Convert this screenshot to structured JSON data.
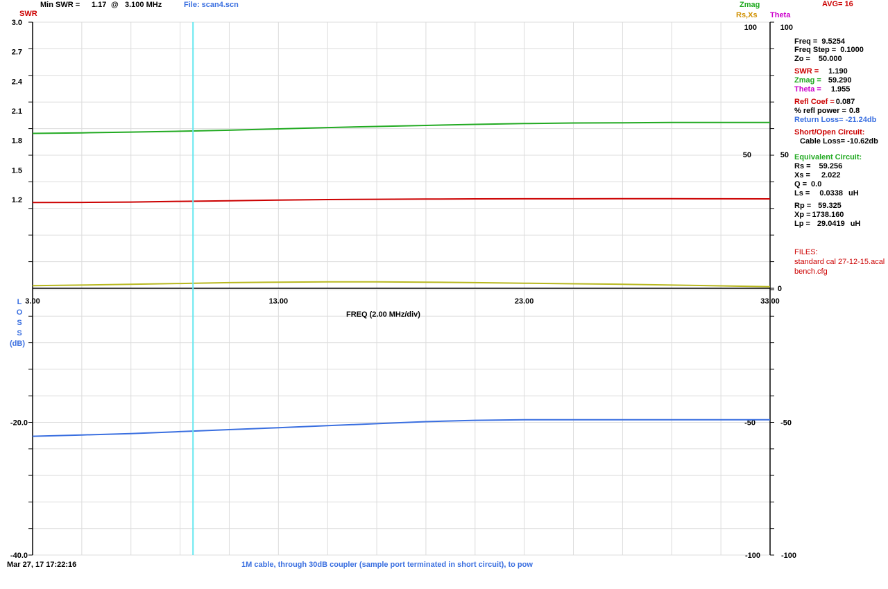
{
  "header": {
    "swr_axis_label": "SWR",
    "min_swr_label": "Min SWR =",
    "min_swr_value": "1.17",
    "min_swr_at": "@",
    "min_swr_freq": "3.100 MHz",
    "file_label": "File: scan4.scn",
    "zmag_label": "Zmag",
    "rsxs_label": "Rs,Xs",
    "theta_label": "Theta",
    "avg_label": "AVG=",
    "avg_value": "16"
  },
  "readout": {
    "freq": {
      "label": "Freq =",
      "value": "9.5254"
    },
    "freq_step": {
      "label": "Freq Step =",
      "value": "0.1000"
    },
    "zo": {
      "label": "Zo =",
      "value": "50.000"
    },
    "swr": {
      "label": "SWR =",
      "value": "1.190"
    },
    "zmag": {
      "label": "Zmag =",
      "value": "59.290"
    },
    "theta": {
      "label": "Theta =",
      "value": "1.955"
    },
    "refl_coef": {
      "label": "Refl Coef =",
      "value": "0.087"
    },
    "refl_power": {
      "label": "% refl power =",
      "value": "0.8"
    },
    "return_loss": "Return Loss= -21.24db",
    "short_open_title": "Short/Open Circuit:",
    "cable_loss": "Cable Loss= -10.62db",
    "equiv_title": "Equivalent Circuit:",
    "rs": {
      "label": "Rs =",
      "value": "59.256"
    },
    "xs": {
      "label": "Xs =",
      "value": "2.022"
    },
    "q": {
      "label": "Q =",
      "value": "0.0"
    },
    "ls": {
      "label": "Ls =",
      "value": "0.0338",
      "unit": "uH"
    },
    "rp": {
      "label": "Rp =",
      "value": "59.325"
    },
    "xp": {
      "label": "Xp =",
      "value": "1738.160"
    },
    "lp": {
      "label": "Lp =",
      "value": "29.0419",
      "unit": "uH"
    },
    "files_title": "FILES:",
    "file1": "standard cal 27-12-15.acal",
    "file2": "bench.cfg"
  },
  "footer": {
    "datetime": "Mar 27, 17   17:22:16",
    "description": "1M cable, through 30dB coupler (sample port terminated in short circuit), to pow"
  },
  "colors": {
    "swr": "#cc0000",
    "zmag": "#22aa22",
    "rs": "#b8b820",
    "loss": "#3a6fe0",
    "cursor": "#66e8f0",
    "grid": "#dcdcdc"
  },
  "chart_data": [
    {
      "type": "line",
      "title": "",
      "xlabel": "FREQ (2.00 MHz/div)",
      "xlim": [
        3,
        33
      ],
      "x_tick_labels": [
        "3.00",
        "13.00",
        "23.00",
        "33.00"
      ],
      "ylabel": "SWR",
      "ylim": [
        0.3,
        3.0
      ],
      "y_tick_labels": [
        "3.0",
        "2.7",
        "2.4",
        "2.1",
        "1.8",
        "1.5",
        "1.2"
      ],
      "right_axes": {
        "zmag_ticks": [
          "100",
          "50"
        ],
        "theta_ticks": [
          "100",
          "50",
          "0"
        ]
      },
      "cursor_freq": 9.5254,
      "grid": true,
      "series": [
        {
          "name": "SWR",
          "axis": "swr",
          "color": "#cc0000",
          "x": [
            3,
            5,
            7,
            9,
            11,
            13,
            15,
            17,
            19,
            21,
            23,
            25,
            27,
            29,
            31,
            33
          ],
          "y": [
            1.17,
            1.171,
            1.175,
            1.182,
            1.188,
            1.195,
            1.2,
            1.203,
            1.205,
            1.207,
            1.208,
            1.208,
            1.209,
            1.209,
            1.208,
            1.207
          ]
        },
        {
          "name": "Zmag",
          "axis": "zmag",
          "color": "#22aa22",
          "x": [
            3,
            5,
            7,
            9,
            11,
            13,
            15,
            17,
            19,
            21,
            23,
            25,
            27,
            29,
            31,
            33
          ],
          "y": [
            58.2,
            58.4,
            58.7,
            59.0,
            59.4,
            59.9,
            60.4,
            60.8,
            61.2,
            61.6,
            61.9,
            62.1,
            62.2,
            62.3,
            62.3,
            62.3
          ]
        },
        {
          "name": "Rs,Xs",
          "axis": "theta",
          "color": "#b8b820",
          "x": [
            3,
            5,
            7,
            9,
            11,
            13,
            15,
            17,
            19,
            21,
            23,
            25,
            27,
            29,
            31,
            33
          ],
          "y": [
            1.0,
            1.2,
            1.5,
            1.8,
            2.1,
            2.3,
            2.4,
            2.4,
            2.3,
            2.1,
            1.9,
            1.7,
            1.5,
            1.2,
            0.9,
            0.6
          ]
        }
      ]
    },
    {
      "type": "line",
      "title": "",
      "ylabel": "LOSS (dB)",
      "xlim": [
        3,
        33
      ],
      "ylim": [
        -40,
        0
      ],
      "y_tick_labels": [
        "-20.0",
        "-40.0"
      ],
      "right_ticks": [
        "-50",
        "-100"
      ],
      "right_ticks_outer": [
        "-50",
        "-100"
      ],
      "grid": true,
      "series": [
        {
          "name": "Loss",
          "color": "#3a6fe0",
          "x": [
            3,
            5,
            7,
            9,
            11,
            13,
            15,
            17,
            19,
            21,
            23,
            25,
            27,
            29,
            31,
            33
          ],
          "y": [
            -22.1,
            -21.9,
            -21.7,
            -21.4,
            -21.1,
            -20.8,
            -20.5,
            -20.2,
            -19.9,
            -19.7,
            -19.6,
            -19.6,
            -19.6,
            -19.6,
            -19.6,
            -19.6
          ]
        }
      ]
    }
  ]
}
